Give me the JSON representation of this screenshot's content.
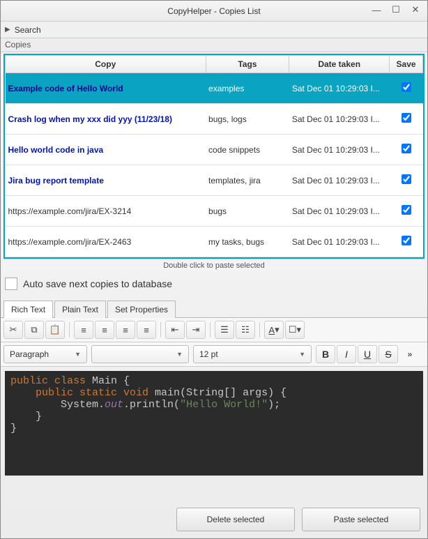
{
  "window": {
    "title": "CopyHelper - Copies List"
  },
  "search": {
    "label": "Search"
  },
  "section": {
    "label": "Copies"
  },
  "table": {
    "headers": {
      "copy": "Copy",
      "tags": "Tags",
      "date": "Date taken",
      "save": "Save"
    },
    "rows": [
      {
        "copy": "Example code of Hello World",
        "link": true,
        "tags": "examples",
        "date": "Sat Dec 01 10:29:03 I...",
        "saved": true,
        "selected": true
      },
      {
        "copy": "Crash log when my xxx did yyy (11/23/18)",
        "link": true,
        "tags": "bugs, logs",
        "date": "Sat Dec 01 10:29:03 I...",
        "saved": true,
        "selected": false
      },
      {
        "copy": "Hello world code in java",
        "link": true,
        "tags": "code snippets",
        "date": "Sat Dec 01 10:29:03 I...",
        "saved": true,
        "selected": false
      },
      {
        "copy": "Jira bug report template",
        "link": true,
        "tags": "templates, jira",
        "date": "Sat Dec 01 10:29:03 I...",
        "saved": true,
        "selected": false
      },
      {
        "copy": "https://example.com/jira/EX-3214",
        "link": false,
        "tags": "bugs",
        "date": "Sat Dec 01 10:29:03 I...",
        "saved": true,
        "selected": false
      },
      {
        "copy": "https://example.com/jira/EX-2463",
        "link": false,
        "tags": "my tasks, bugs",
        "date": "Sat Dec 01 10:29:03 I...",
        "saved": true,
        "selected": false
      }
    ]
  },
  "hint": "Double click to paste selected",
  "autosave": {
    "label": "Auto save next copies to database",
    "checked": false
  },
  "tabs": {
    "items": [
      "Rich Text",
      "Plain Text",
      "Set Properties"
    ],
    "active": 0
  },
  "format": {
    "paragraph": "Paragraph",
    "font": "",
    "size": "12 pt"
  },
  "code": {
    "l1a": "public",
    "l1b": " class",
    "l1c": " Main {",
    "l2a": "    public",
    "l2b": " static",
    "l2c": " void",
    "l2d": " main",
    "l2e": "(String[] args) {",
    "l3a": "        System.",
    "l3b": "out",
    "l3c": ".println(",
    "l3d": "\"Hello World!\"",
    "l3e": ");",
    "l4": "    }",
    "l5": "}"
  },
  "footer": {
    "delete": "Delete selected",
    "paste": "Paste selected"
  }
}
